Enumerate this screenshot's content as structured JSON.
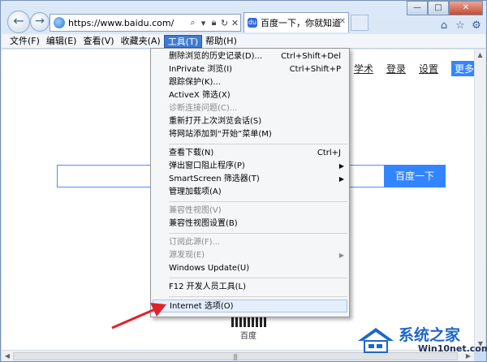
{
  "address_bar": {
    "url": "https://www.baidu.com/",
    "icons": [
      "globe-icon",
      "search-icon",
      "dropdown-icon",
      "lock-icon",
      "refresh-icon",
      "close-icon"
    ]
  },
  "tab": {
    "label": "百度一下，你就知道"
  },
  "window_controls": {
    "minimize": "—",
    "maximize": "□",
    "close": "✕"
  },
  "menubar": {
    "items": [
      "文件(F)",
      "编辑(E)",
      "查看(V)",
      "收藏夹(A)",
      "工具(T)",
      "帮助(H)"
    ],
    "active_index": 4
  },
  "page": {
    "toplinks": [
      "学术",
      "登录",
      "设置"
    ],
    "more_button": "更多产",
    "search_button": "百度一下",
    "qr_label": "百度"
  },
  "tools_menu": {
    "items": [
      {
        "label": "删除浏览的历史记录(D)...",
        "shortcut": "Ctrl+Shift+Del"
      },
      {
        "label": "InPrivate 浏览(I)",
        "shortcut": "Ctrl+Shift+P"
      },
      {
        "label": "跟踪保护(K)..."
      },
      {
        "label": "ActiveX 筛选(X)"
      },
      {
        "label": "诊断连接问题(C)...",
        "disabled": true
      },
      {
        "label": "重新打开上次浏览会话(S)"
      },
      {
        "label": "将网站添加到“开始”菜单(M)"
      },
      {
        "label": "查看下载(N)",
        "shortcut": "Ctrl+J"
      },
      {
        "label": "弹出窗口阻止程序(P)"
      },
      {
        "label": "SmartScreen 筛选器(T)"
      },
      {
        "label": "管理加载项(A)"
      },
      {
        "label": "兼容性视图(V)",
        "disabled": true
      },
      {
        "label": "兼容性视图设置(B)"
      },
      {
        "label": "订阅此源(F)...",
        "disabled": true
      },
      {
        "label": "源发现(E)",
        "disabled": true
      },
      {
        "label": "Windows Update(U)"
      },
      {
        "label": "F12 开发人员工具(L)"
      },
      {
        "label": "Internet 选项(O)",
        "highlighted": true
      }
    ]
  },
  "watermark": {
    "title": "系统之家",
    "subtitle": "Win10net.com"
  },
  "colors": {
    "accent": "#3385ff",
    "menu_active": "#3f7bd3",
    "arrow": "#e0232a",
    "watermark": "#1f66c6"
  }
}
